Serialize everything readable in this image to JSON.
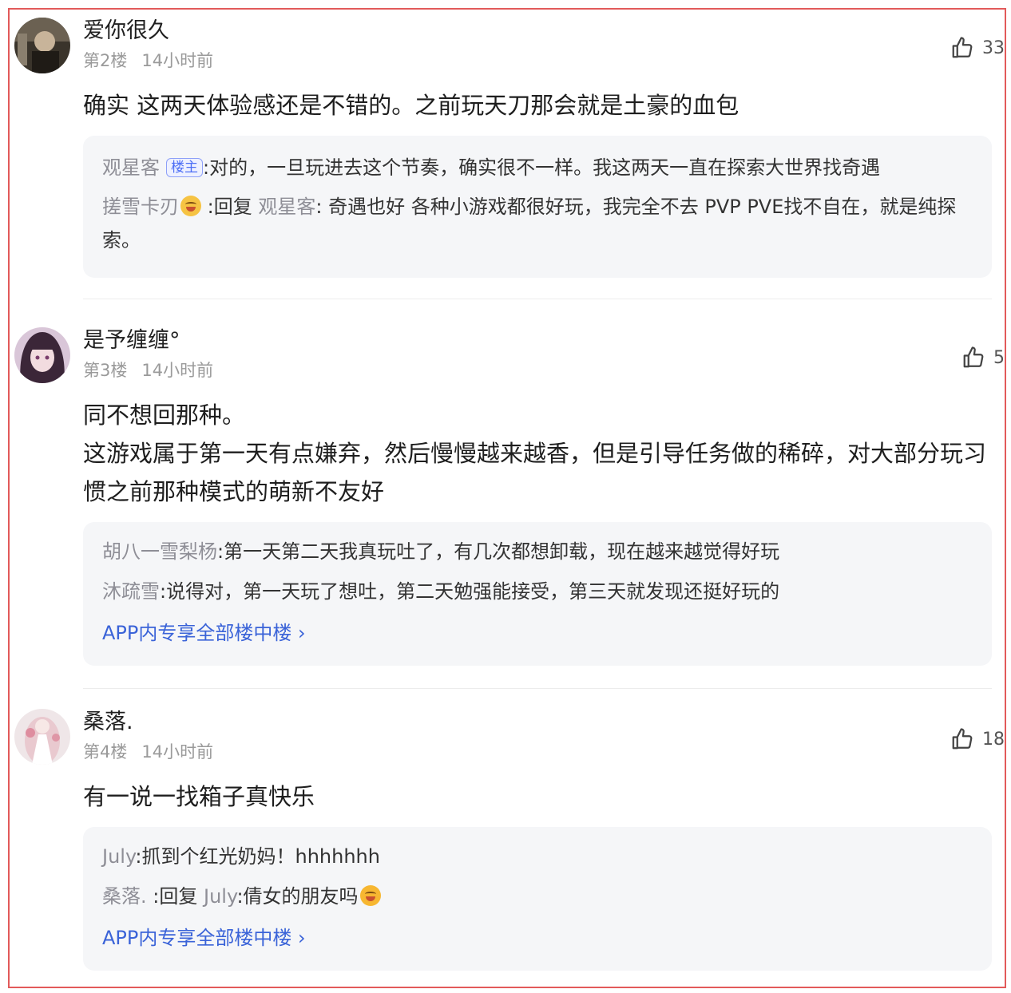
{
  "comments": [
    {
      "username": "爱你很久",
      "floor": "第2楼",
      "time": "14小时前",
      "likes": "33",
      "content": [
        "确实 这两天体验感还是不错的。之前玩天刀那会就是土豪的血包"
      ],
      "replies": [
        {
          "name": "观星客",
          "tag": "楼主",
          "text": ":对的，一旦玩进去这个节奏，确实很不一样。我这两天一直在探索大世界找奇遇"
        },
        {
          "name": "搓雪卡刃",
          "reply_prefix": ":回复",
          "reply_to": "观星客",
          "text": ": 奇遇也好 各种小游戏都很好玩，我完全不去 PVP PVE找不自在，就是纯探索。"
        }
      ]
    },
    {
      "username": "是予缠缠°",
      "floor": "第3楼",
      "time": "14小时前",
      "likes": "5",
      "content": [
        "同不想回那种。",
        "这游戏属于第一天有点嫌弃，然后慢慢越来越香，但是引导任务做的稀碎，对大部分玩习惯之前那种模式的萌新不友好"
      ],
      "replies": [
        {
          "name": "胡八一雪梨杨",
          "text": ":第一天第二天我真玩吐了，有几次都想卸载，现在越来越觉得好玩"
        },
        {
          "name": "沐疏雪",
          "text": ":说得对，第一天玩了想吐，第二天勉强能接受，第三天就发现还挺好玩的"
        }
      ],
      "more": "APP内专享全部楼中楼 ›"
    },
    {
      "username": "桑落.",
      "floor": "第4楼",
      "time": "14小时前",
      "likes": "18",
      "content": [
        "有一说一找箱子真快乐"
      ],
      "replies": [
        {
          "name": "July",
          "text": ":抓到个红光奶妈！hhhhhhh"
        },
        {
          "name": "桑落.",
          "reply_prefix": ":回复",
          "reply_to": "July",
          "text": ":倩女的朋友吗"
        }
      ],
      "more": "APP内专享全部楼中楼 ›"
    }
  ],
  "icons": {
    "like": "thumbs-up-icon",
    "emoji_laugh": "laughing-emoji-icon",
    "emoji_shock": "shocked-emoji-icon"
  },
  "colors": {
    "border": "#e25a5a",
    "link": "#3a63d8",
    "reply_bg": "#f5f6f8",
    "tag": "#4c6ef5"
  }
}
